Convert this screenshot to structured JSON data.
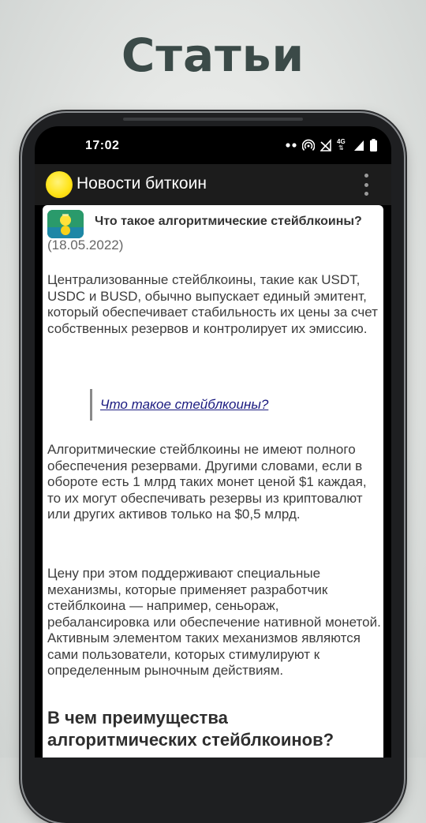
{
  "promo": {
    "title": "Статьи"
  },
  "status_bar": {
    "time": "17:02",
    "icons": [
      "notification-dots-icon",
      "hotspot-icon",
      "no-signal-icon",
      "4g-icon",
      "signal-icon",
      "battery-icon"
    ],
    "network_label": "4G"
  },
  "app_bar": {
    "title": "Новости биткоин",
    "logo_color": "#FFE41A",
    "menu_icon": "overflow-menu-icon"
  },
  "article": {
    "title": "Что такое алгоритмические стейблкоины?",
    "date": "(18.05.2022)",
    "paragraphs": [
      "Централизованные стейблкоины, такие как USDT, USDC и BUSD, обычно выпускает единый эмитент, который обеспечивает стабильность их цены за счет собственных резервов и контролирует их эмиссию.",
      "Алгоритмические стейблкоины не имеют полного обеспечения резервами. Другими словами, если в обороте есть 1 млрд таких монет ценой $1 каждая, то их могут обеспечивать резервы из криптовалют или других активов только на $0,5 млрд.",
      "Цену при этом поддерживают специальные механизмы, которые применяет разработчик стейблкоина — например, сеньораж, ребалансировка или обеспечение нативной монетой. Активным элементом таких механизмов являются сами пользователи, которых стимулируют к определенным рыночным действиям."
    ],
    "quote_link": "Что такое стейблкоины?",
    "subheading": "В чем преимущества алгоритмических стейблкоинов?"
  },
  "colors": {
    "promo_title": "#3B4A48",
    "app_bar_bg": "#1C1C1C",
    "link": "#1A1A80"
  }
}
